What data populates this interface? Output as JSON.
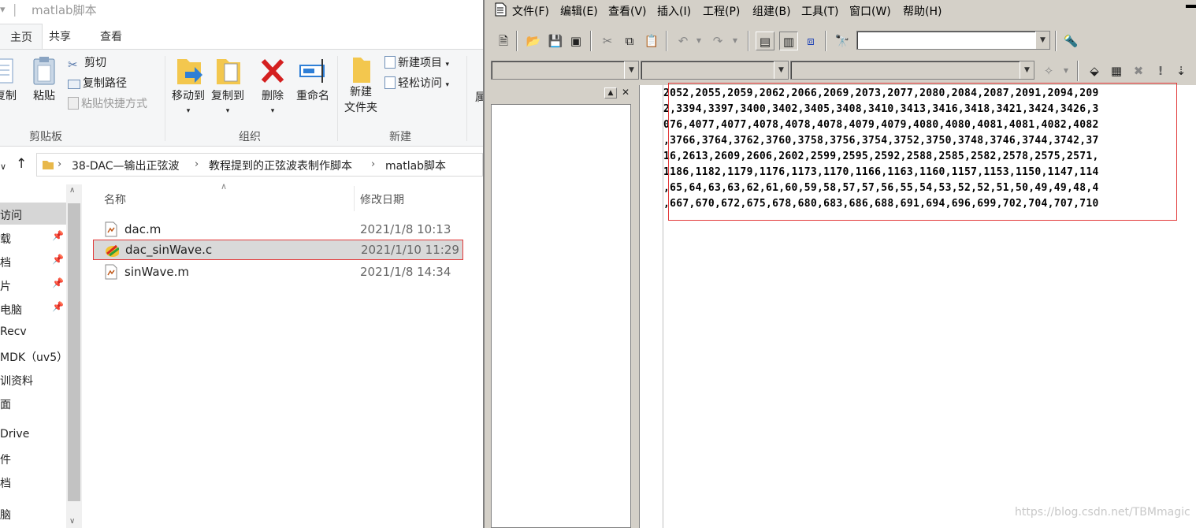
{
  "explorer": {
    "title": "matlab脚本",
    "tabs": [
      "主页",
      "共享",
      "查看"
    ],
    "ribbon": {
      "clipboard": {
        "copy": "复制",
        "paste": "粘贴",
        "cut": "剪切",
        "copy_path": "复制路径",
        "paste_shortcut": "粘贴快捷方式",
        "group": "剪贴板"
      },
      "organize": {
        "move_to": "移动到",
        "copy_to": "复制到",
        "delete": "删除",
        "rename": "重命名",
        "group": "组织"
      },
      "new": {
        "new_folder_1": "新建",
        "new_folder_2": "文件夹",
        "new_item": "新建项目",
        "easy_access": "轻松访问",
        "group": "新建"
      },
      "partial": "属"
    },
    "breadcrumb": [
      "38-DAC—输出正弦波",
      "教程提到的正弦波表制作脚本",
      "matlab脚本"
    ],
    "nav": [
      "访问",
      "载",
      "档",
      "片",
      "电脑",
      "Recv",
      "MDK（uv5）",
      "训资料",
      "面",
      "Drive",
      "件",
      "档",
      "脑"
    ],
    "columns": {
      "name": "名称",
      "date": "修改日期"
    },
    "files": [
      {
        "name": "dac.m",
        "date": "2021/1/8 10:13",
        "icon": "matlab-file-icon"
      },
      {
        "name": "dac_sinWave.c",
        "date": "2021/1/10 11:29",
        "icon": "c-source-file-icon"
      },
      {
        "name": "sinWave.m",
        "date": "2021/1/8 14:34",
        "icon": "matlab-file-icon"
      }
    ]
  },
  "editor": {
    "menu": [
      "文件(F)",
      "编辑(E)",
      "查看(V)",
      "插入(I)",
      "工程(P)",
      "组建(B)",
      "工具(T)",
      "窗口(W)",
      "帮助(H)"
    ],
    "code_lines": [
      "2052,2055,2059,2062,2066,2069,2073,2077,2080,2084,2087,2091,2094,209",
      "2,3394,3397,3400,3402,3405,3408,3410,3413,3416,3418,3421,3424,3426,3",
      "076,4077,4077,4078,4078,4078,4079,4079,4080,4080,4081,4081,4082,4082",
      ",3766,3764,3762,3760,3758,3756,3754,3752,3750,3748,3746,3744,3742,37",
      "16,2613,2609,2606,2602,2599,2595,2592,2588,2585,2582,2578,2575,2571,",
      "1186,1182,1179,1176,1173,1170,1166,1163,1160,1157,1153,1150,1147,114",
      ",65,64,63,63,62,61,60,59,58,57,57,56,55,54,53,52,52,51,50,49,49,48,4",
      ",667,670,672,675,678,680,683,686,688,691,694,696,699,702,704,707,710"
    ]
  },
  "watermark": "https://blog.csdn.net/TBMmagic",
  "colors": {
    "highlight": "#e23a3a",
    "classic_gray": "#d4d0c8"
  }
}
